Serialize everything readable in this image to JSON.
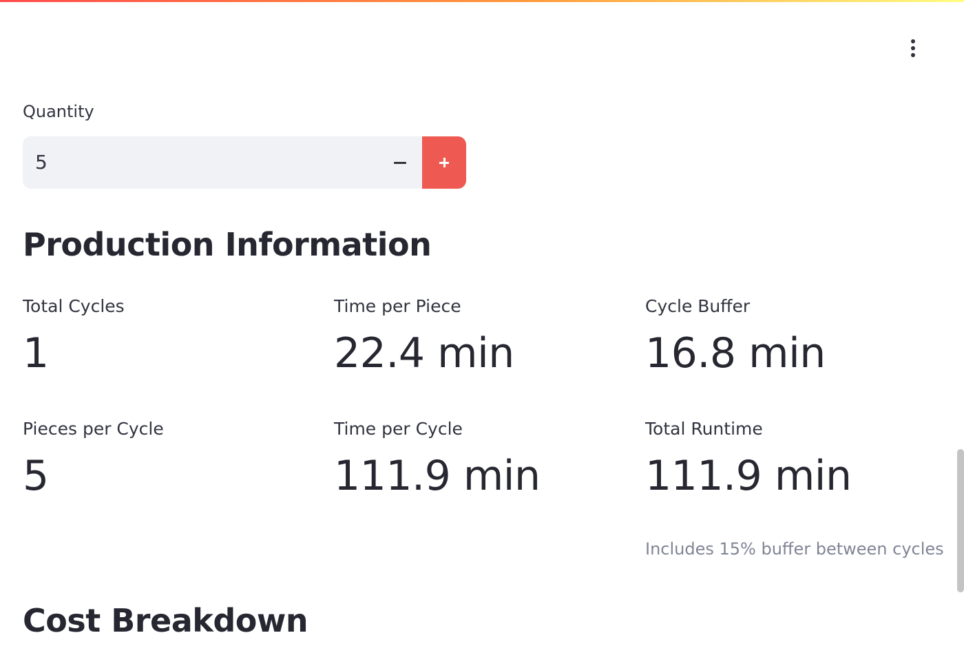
{
  "header": {
    "menu_icon": "kebab-menu-icon",
    "accent_colors": [
      "#ff4b4b",
      "#ff9a3c",
      "#fffd80"
    ]
  },
  "quantity": {
    "label": "Quantity",
    "value": "5",
    "minus_icon": "minus-icon",
    "plus_icon": "plus-icon",
    "accent": "#ee5a52"
  },
  "production": {
    "heading": "Production Information",
    "metrics": [
      {
        "label": "Total Cycles",
        "value": "1"
      },
      {
        "label": "Time per Piece",
        "value": "22.4 min"
      },
      {
        "label": "Cycle Buffer",
        "value": "16.8 min"
      },
      {
        "label": "Pieces per Cycle",
        "value": "5"
      },
      {
        "label": "Time per Cycle",
        "value": "111.9 min"
      },
      {
        "label": "Total Runtime",
        "value": "111.9 min"
      }
    ],
    "runtime_caption": "Includes 15% buffer between cycles"
  },
  "cost": {
    "heading": "Cost Breakdown"
  }
}
